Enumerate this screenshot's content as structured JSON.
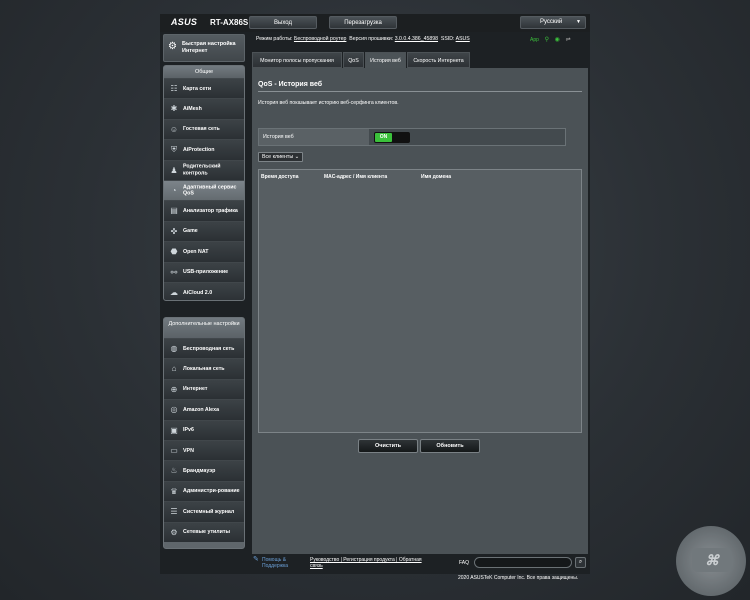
{
  "header": {
    "logo": "ASUS",
    "model": "RT-AX86S",
    "logout_label": "Выход",
    "reboot_label": "Перезагрузка",
    "language": "Русский"
  },
  "status": {
    "mode_label": "Режим работы:",
    "mode_value": "Беспроводной роутер",
    "firmware_label": "Версия прошивки:",
    "firmware_value": "3.0.0.4.386_45898",
    "ssid_label": "SSID:",
    "ssid_value": "ASUS",
    "app_label": "App"
  },
  "sidebar": {
    "quick_setup": "Быстрая настройка Интернет",
    "general_header": "Общие",
    "general_items": [
      {
        "label": "Карта сети",
        "icon": "network-map-icon"
      },
      {
        "label": "AiMesh",
        "icon": "aimesh-icon"
      },
      {
        "label": "Гостевая сеть",
        "icon": "guest-network-icon"
      },
      {
        "label": "AiProtection",
        "icon": "shield-icon"
      },
      {
        "label": "Родительский контроль",
        "icon": "parental-control-icon"
      },
      {
        "label": "Адаптивный сервис QoS",
        "icon": "qos-icon"
      },
      {
        "label": "Анализатор трафика",
        "icon": "traffic-analyzer-icon"
      },
      {
        "label": "Game",
        "icon": "gamepad-icon"
      },
      {
        "label": "Open NAT",
        "icon": "open-nat-icon"
      },
      {
        "label": "USB-приложение",
        "icon": "usb-icon"
      },
      {
        "label": "AiCloud 2.0",
        "icon": "cloud-icon"
      }
    ],
    "advanced_header": "Дополнительные настройки",
    "advanced_items": [
      {
        "label": "Беспроводная сеть",
        "icon": "wireless-icon"
      },
      {
        "label": "Локальная сеть",
        "icon": "lan-icon"
      },
      {
        "label": "Интернет",
        "icon": "globe-icon"
      },
      {
        "label": "Amazon Alexa",
        "icon": "alexa-icon"
      },
      {
        "label": "IPv6",
        "icon": "ipv6-icon"
      },
      {
        "label": "VPN",
        "icon": "vpn-icon"
      },
      {
        "label": "Брандмауэр",
        "icon": "firewall-icon"
      },
      {
        "label": "Администри-рование",
        "icon": "admin-icon"
      },
      {
        "label": "Системный журнал",
        "icon": "system-log-icon"
      },
      {
        "label": "Сетевые утилиты",
        "icon": "network-tools-icon"
      }
    ]
  },
  "tabs": [
    {
      "label": "Монитор полосы пропускания"
    },
    {
      "label": "QoS"
    },
    {
      "label": "История веб"
    },
    {
      "label": "Скорость Интернета"
    }
  ],
  "main": {
    "title": "QoS - История веб",
    "description": "История веб показывает историю веб-серфинга клиентов.",
    "toggle_label": "История веб",
    "toggle_state": "ON",
    "client_filter": "Все клиенты",
    "columns": [
      "Время доступа",
      "MAC-адрес / Имя клиента",
      "Имя домена"
    ],
    "clear_button": "Очистить",
    "refresh_button": "Обновить"
  },
  "footer": {
    "help_line1": "Помощь &",
    "help_line2": "Поддержка",
    "links_line1": "Руководство | Регистрация продукта | Обратная",
    "links_line2": "связь",
    "faq_label": "FAQ",
    "copyright": "2020 ASUSTeK Computer Inc. Все права защищены."
  },
  "colors": {
    "accent_on": "#3bc13b",
    "link_blue": "#6b9fd6"
  }
}
